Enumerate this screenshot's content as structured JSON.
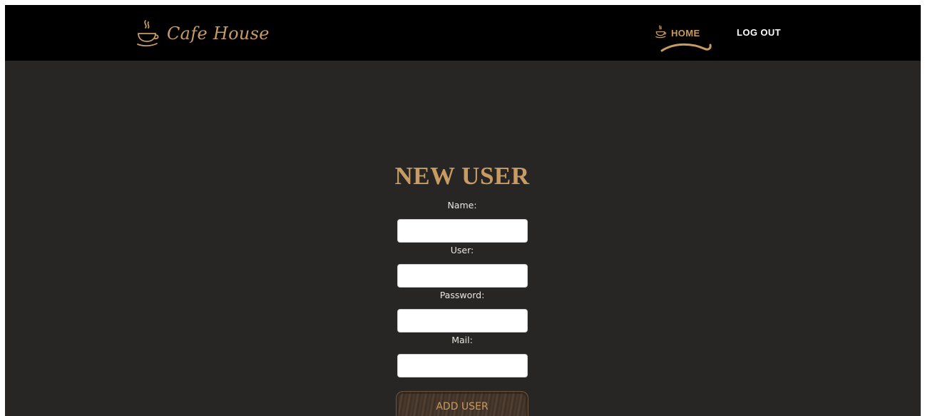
{
  "navbar": {
    "brand_name": "Cafe House",
    "home_label": "HOME",
    "logout_label": "LOG OUT"
  },
  "form": {
    "title": "NEW USER",
    "fields": [
      {
        "label": "Name:",
        "value": ""
      },
      {
        "label": "User:",
        "value": ""
      },
      {
        "label": "Password:",
        "value": ""
      },
      {
        "label": "Mail:",
        "value": ""
      }
    ],
    "submit_label": "ADD USER"
  },
  "colors": {
    "accent": "#c89b63",
    "navbar_bg": "#000000",
    "page_bg": "#282624",
    "label_text": "#e8e6e2"
  },
  "icons": {
    "brand": "coffee-cup-icon",
    "home": "coffee-cup-icon"
  }
}
